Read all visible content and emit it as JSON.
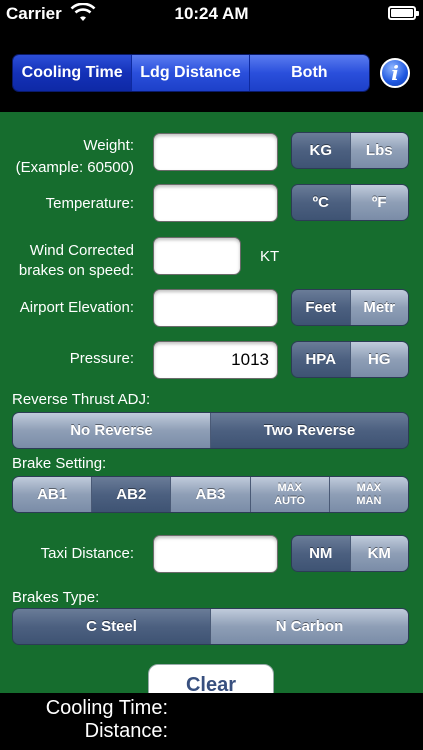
{
  "status_bar": {
    "carrier": "Carrier",
    "time": "10:24 AM"
  },
  "nav": {
    "tabs": [
      {
        "label": "Cooling Time",
        "selected": true
      },
      {
        "label": "Ldg Distance",
        "selected": false
      },
      {
        "label": "Both",
        "selected": false
      }
    ],
    "info_label": "i"
  },
  "form": {
    "weight": {
      "label": "Weight:",
      "example": "(Example:  60500)",
      "value": "",
      "units": [
        "KG",
        "Lbs"
      ]
    },
    "temperature": {
      "label": "Temperature:",
      "value": "",
      "units": [
        "ºC",
        "ºF"
      ]
    },
    "wind": {
      "label_line1": "Wind Corrected",
      "label_line2": "brakes on speed:",
      "value": "",
      "unit": "KT"
    },
    "elevation": {
      "label": "Airport Elevation:",
      "value": "",
      "units": [
        "Feet",
        "Metr"
      ]
    },
    "pressure": {
      "label": "Pressure:",
      "value": "1013",
      "units": [
        "HPA",
        "HG"
      ]
    },
    "reverse": {
      "label": "Reverse Thrust ADJ:",
      "options": [
        "No Reverse",
        "Two Reverse"
      ]
    },
    "brake_setting": {
      "label": "Brake Setting:",
      "options": [
        "AB1",
        "AB2",
        "AB3"
      ],
      "max_auto": [
        "MAX",
        "AUTO"
      ],
      "max_man": [
        "MAX",
        "MAN"
      ]
    },
    "taxi": {
      "label": "Taxi Distance:",
      "value": "",
      "units": [
        "NM",
        "KM"
      ]
    },
    "brakes_type": {
      "label": "Brakes Type:",
      "options": [
        "C Steel",
        "N Carbon"
      ]
    },
    "clear_label": "Clear"
  },
  "results": {
    "cooling_label": "Cooling Time:",
    "distance_label": "Distance:"
  },
  "colors": {
    "form_bg": "#166d2e",
    "nav_blue": "#2a4fdc",
    "segment_gray": "#8e9eb6",
    "segment_selected": "#4c6080"
  }
}
